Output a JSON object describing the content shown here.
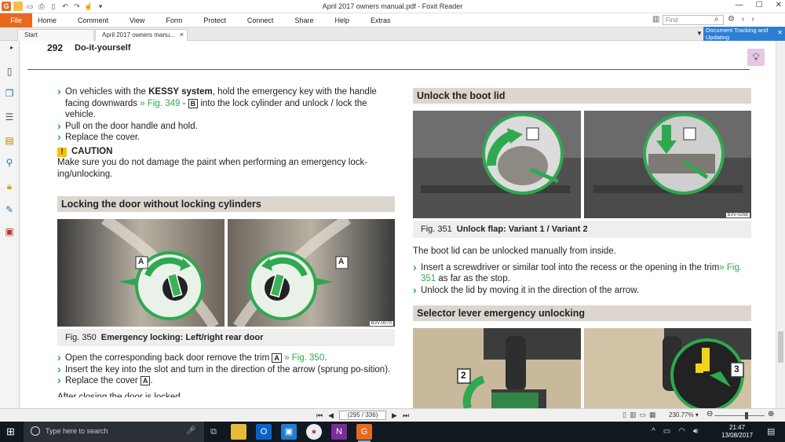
{
  "window": {
    "title": "April 2017 owners manual.pdf - Foxit Reader",
    "controls": [
      "—",
      "☐",
      "✕"
    ]
  },
  "menu": {
    "file": "File",
    "items": [
      "Home",
      "Comment",
      "View",
      "Form",
      "Protect",
      "Connect",
      "Share",
      "Help",
      "Extras"
    ],
    "search_placeholder": "Find"
  },
  "tabs": {
    "start": "Start",
    "doc": "April 2017 owners manu...",
    "close": "×"
  },
  "banner": {
    "text": "Document Tracking and Updating",
    "close": "✕"
  },
  "page": {
    "number": "292",
    "header": "Do-it-yourself",
    "left": {
      "b1_pre": "On vehicles with the ",
      "b1_bold": "KESSY system",
      "b1_mid": ", hold the emergency key with the handle facing downwards ",
      "b1_link": "» Fig. 349",
      "b1_dash": " - ",
      "b1_key": "B",
      "b1_post": " into the lock cylinder and unlock / lock the vehicle.",
      "b2": "Pull on the door handle and hold.",
      "b3": "Replace the cover.",
      "caution_title": "CAUTION",
      "caution_text": "Make sure you do not damage the paint when performing an emergency lock-ing/unlocking.",
      "section1": "Locking the door without locking cylinders",
      "fig_label": "Fig. 350",
      "fig_title": "Emergency locking: Left/right rear door",
      "photo_code": "B3V-0070",
      "marker_a": "A",
      "b4_pre": "Open the corresponding back door remove the trim ",
      "b4_key": "A",
      "b4_link": " » Fig. 350",
      "b4_post": ".",
      "b5": "Insert the key into the slot and turn in the direction of the arrow (sprung po-sition).",
      "b6_pre": "Replace the cover ",
      "b6_key": "A",
      "b6_post": ".",
      "cut_text": "After closing the door is locked"
    },
    "right": {
      "section2": "Unlock the boot lid",
      "fig_label": "Fig. 351",
      "fig_title": "Unlock flap: Variant 1 / Variant 2",
      "photo_code": "B3V-0268",
      "para": "The boot lid can be unlocked manually from inside.",
      "b1_pre": "Insert a screwdriver or similar tool into the recess or the opening in the trim",
      "b1_link": "» Fig. 351",
      "b1_post": " as far as the stop.",
      "b2": "Unlock the lid by moving it in the direction of the arrow.",
      "section3": "Selector lever emergency unlocking",
      "marker_2": "2",
      "marker_3": "3"
    }
  },
  "status": {
    "page_field": "(295 / 336)",
    "zoom": "230.77%"
  },
  "taskbar": {
    "search": "Type here to search",
    "time": "21:47",
    "date": "13/08/2017"
  },
  "colors": {
    "accent_orange": "#e8691e",
    "link_green": "#2fa84f",
    "section_bar": "#ddd6cf",
    "banner_blue": "#2b7fd4"
  }
}
